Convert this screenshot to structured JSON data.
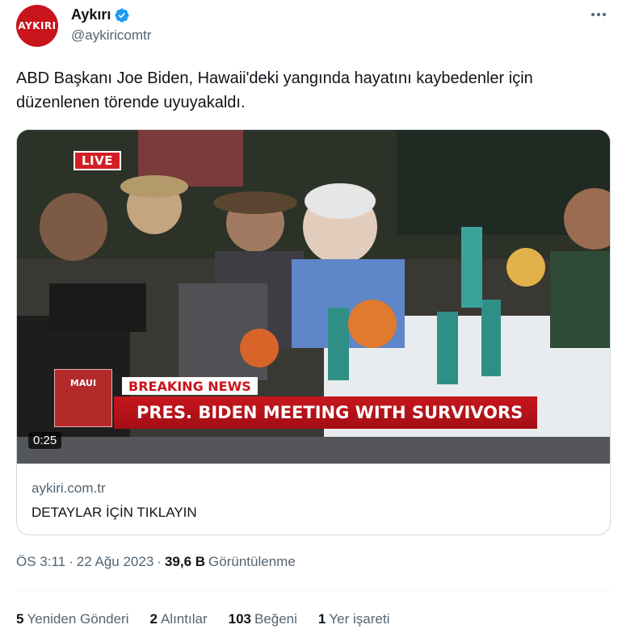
{
  "author": {
    "avatar_text": "AYKIRI",
    "display_name": "Aykırı",
    "handle": "@aykiricomtr",
    "verified": true
  },
  "tweet": {
    "text_line1": "ABD Başkanı Joe Biden, Hawaii'deki yangında hayatını kaybedenler için",
    "text_line2": "düzenlenen törende uyuyakaldı."
  },
  "video": {
    "live_label": "LIVE",
    "maui_label": "MAUI",
    "breaking_label": "BREAKING NEWS",
    "headline": "PRES. BIDEN MEETING WITH SURVIVORS",
    "duration": "0:25"
  },
  "card": {
    "domain": "aykiri.com.tr",
    "title": "DETAYLAR İÇİN TIKLAYIN"
  },
  "meta": {
    "time": "ÖS 3:11",
    "separator": "·",
    "date": "22 Ağu 2023",
    "views_count": "39,6 B",
    "views_label": "Görüntülenme"
  },
  "stats": {
    "reposts_count": "5",
    "reposts_label": "Yeniden Gönderi",
    "quotes_count": "2",
    "quotes_label": "Alıntılar",
    "likes_count": "103",
    "likes_label": "Beğeni",
    "bookmarks_count": "1",
    "bookmarks_label": "Yer işareti"
  },
  "colors": {
    "verified_blue": "#1d9bf0",
    "brand_red": "#c8141b",
    "secondary_text": "#536471"
  }
}
